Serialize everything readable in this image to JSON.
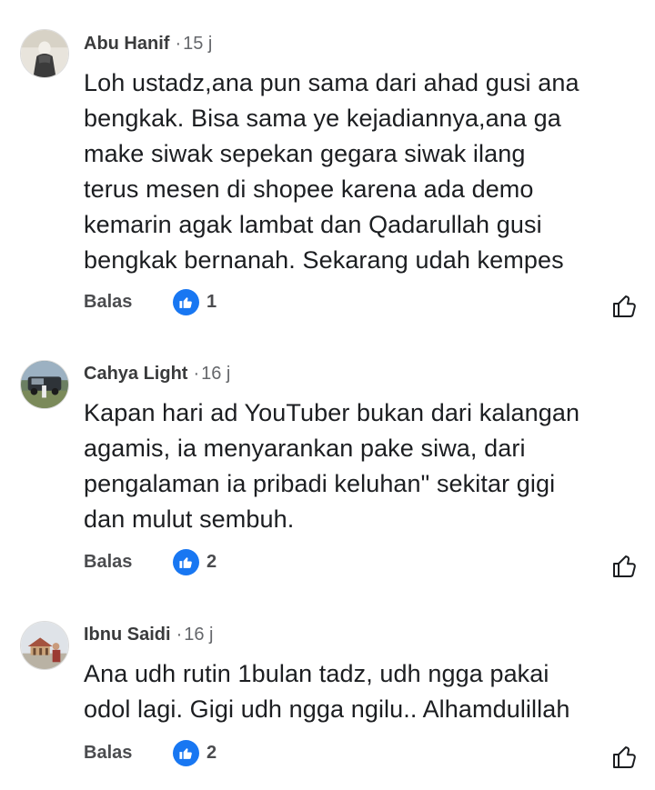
{
  "comments": [
    {
      "author": "Abu Hanif",
      "time": "15 j",
      "text": "Loh ustadz,ana pun sama dari ahad gusi ana\nbengkak. Bisa sama ye kejadiannya,ana ga\nmake siwak sepekan gegara siwak ilang\nterus mesen di shopee karena ada demo\nkemarin agak lambat dan Qadarullah gusi\nbengkak bernanah. Sekarang udah kempes",
      "reply_label": "Balas",
      "reaction_count": "1"
    },
    {
      "author": "Cahya Light",
      "time": "16 j",
      "text": "Kapan hari ad YouTuber bukan dari kalangan\nagamis, ia menyarankan pake siwa, dari\npengalaman ia pribadi keluhan\" sekitar gigi\ndan mulut sembuh.",
      "reply_label": "Balas",
      "reaction_count": "2"
    },
    {
      "author": "Ibnu Saidi",
      "time": "16 j",
      "text": "Ana udh rutin 1bulan tadz, udh ngga pakai\nodol lagi. Gigi udh ngga ngilu.. Alhamdulillah",
      "reply_label": "Balas",
      "reaction_count": "2"
    }
  ],
  "separator": "·",
  "colors": {
    "accent": "#1877f2",
    "author": "#3a3b3c",
    "meta": "#65676b"
  },
  "icons": {
    "reaction": "thumbs-up-icon",
    "like_button": "thumbs-up-outline-icon"
  }
}
